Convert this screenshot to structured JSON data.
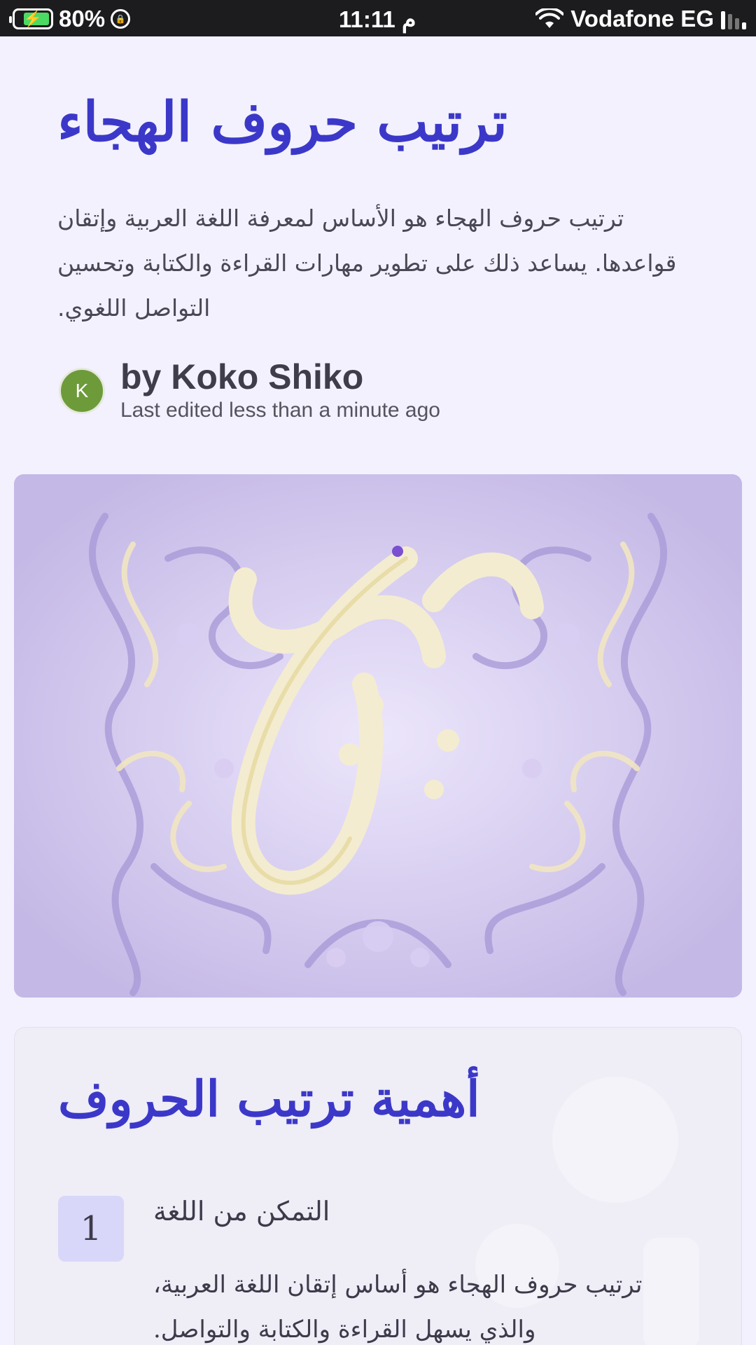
{
  "status_bar": {
    "battery_percent": "80%",
    "time": "11:11 م",
    "carrier": "Vodafone EG",
    "battery_level": 0.8,
    "accent_charge": "#4cd964"
  },
  "header": {
    "title": "ترتيب حروف الهجاء",
    "description_lines": [
      "ترتيب حروف الهجاء هو الأساس لمعرفة اللغة العربية وإتقان",
      "قواعدها. يساعد ذلك على تطوير مهارات القراءة والكتابة وتحسين",
      "التواصل اللغوي."
    ]
  },
  "author": {
    "avatar_initial": "K",
    "name": "by Koko Shiko",
    "edited": "Last edited less than a minute ago"
  },
  "hero": {
    "alt": "",
    "icon": "arabic-calligraphy-illustration"
  },
  "section": {
    "title": "أهمية ترتيب الحروف",
    "items": [
      {
        "number": "1",
        "title": "التمكن من اللغة",
        "text_lines": [
          "ترتيب حروف الهجاء هو أساس إتقان اللغة العربية،",
          "والذي يسهل القراءة والكتابة والتواصل."
        ]
      }
    ]
  },
  "colors": {
    "background": "#f3f1fd",
    "title": "#3b38c9",
    "badge": "#d9d7f9",
    "avatar": "#6e9b3a"
  }
}
